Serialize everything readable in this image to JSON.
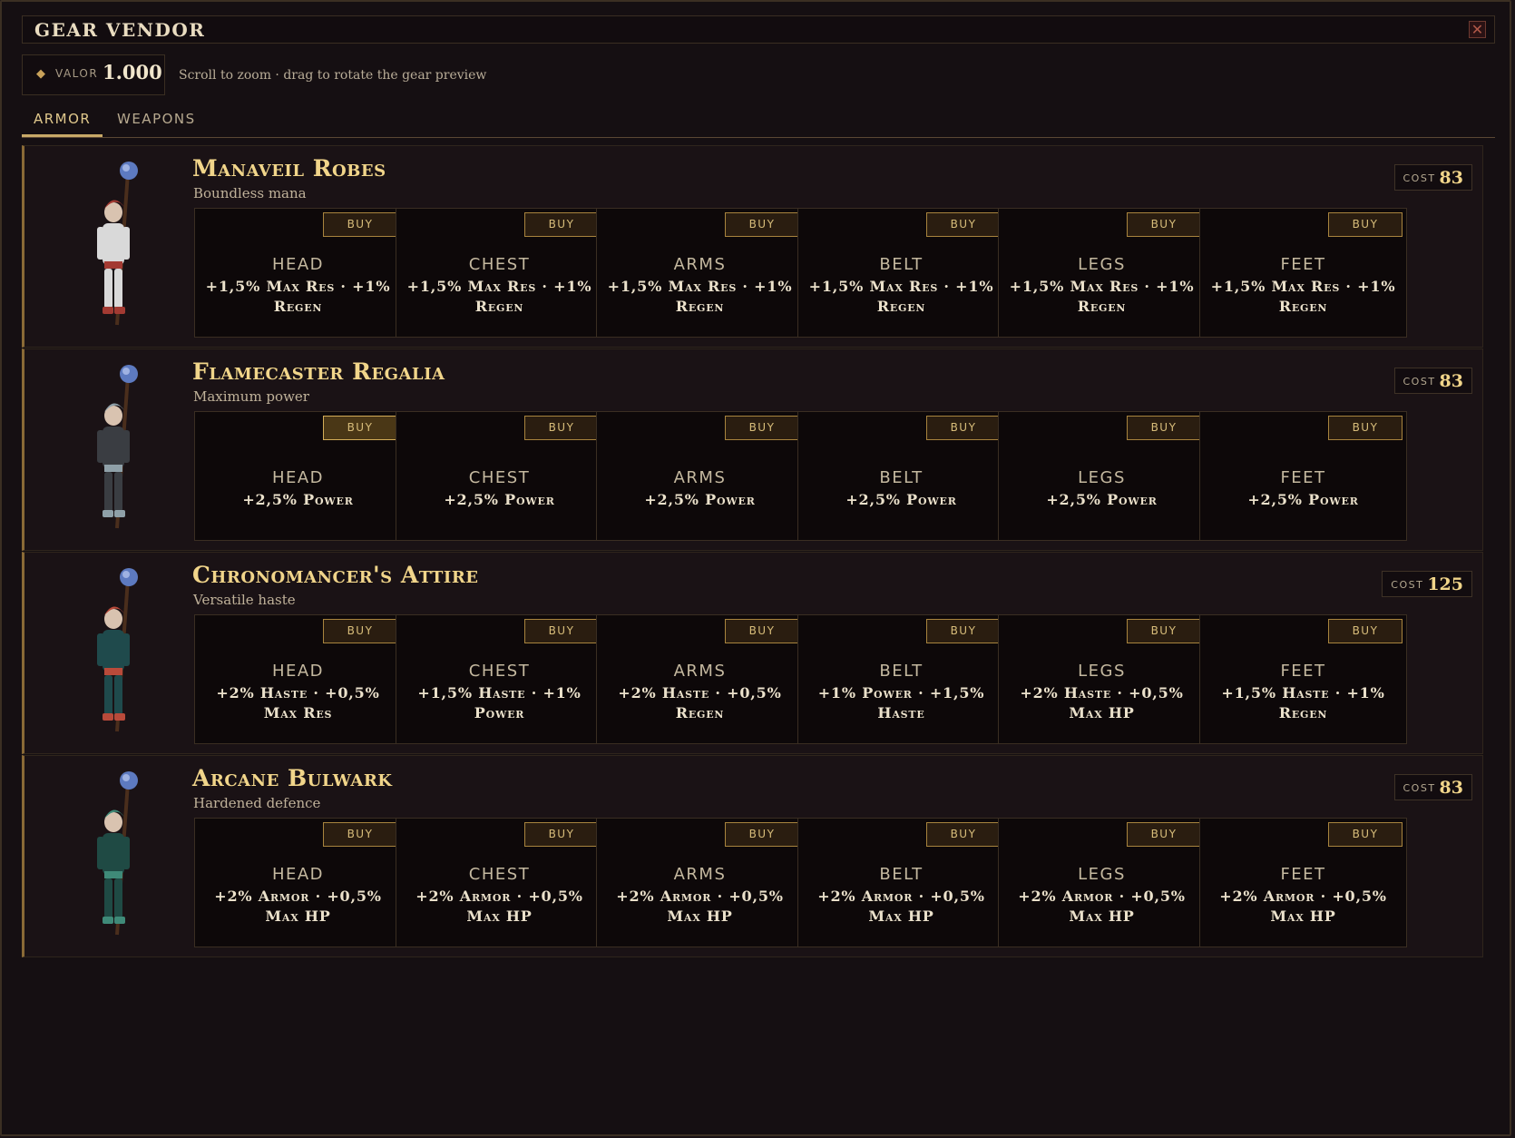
{
  "window": {
    "title": "GEAR VENDOR",
    "close_label": "✕"
  },
  "currency": {
    "icon": "diamond-icon",
    "symbol": "◆",
    "label": "VALOR",
    "amount": "1.000"
  },
  "hint": "Scroll to zoom · drag to rotate the gear preview",
  "tabs": [
    {
      "label": "ARMOR",
      "active": true
    },
    {
      "label": "WEAPONS",
      "active": false
    }
  ],
  "buy_label": "BUY",
  "cost_label": "COST",
  "colors": {
    "accent": "#f1d58a",
    "buy_border": "#a8843e",
    "background": "#150f12"
  },
  "sets": [
    {
      "name": "Manaveil Robes",
      "description": "Boundless mana",
      "cost": "83",
      "preview_colors": {
        "outfit": "#d9d9d9",
        "accent": "#a33a32",
        "orb": "#5d7ac0"
      },
      "pieces": [
        {
          "slot": "HEAD",
          "stat": "+1,5% Max Res · +1% Regen"
        },
        {
          "slot": "CHEST",
          "stat": "+1,5% Max Res · +1% Regen"
        },
        {
          "slot": "ARMS",
          "stat": "+1,5% Max Res · +1% Regen"
        },
        {
          "slot": "BELT",
          "stat": "+1,5% Max Res · +1% Regen"
        },
        {
          "slot": "LEGS",
          "stat": "+1,5% Max Res · +1% Regen"
        },
        {
          "slot": "FEET",
          "stat": "+1,5% Max Res · +1% Regen"
        }
      ]
    },
    {
      "name": "Flamecaster Regalia",
      "description": "Maximum power",
      "cost": "83",
      "preview_colors": {
        "outfit": "#3a3d42",
        "accent": "#8fa0a8",
        "orb": "#5d7ac0"
      },
      "pieces": [
        {
          "slot": "HEAD",
          "stat": "+2,5% Power"
        },
        {
          "slot": "CHEST",
          "stat": "+2,5% Power"
        },
        {
          "slot": "ARMS",
          "stat": "+2,5% Power"
        },
        {
          "slot": "BELT",
          "stat": "+2,5% Power"
        },
        {
          "slot": "LEGS",
          "stat": "+2,5% Power"
        },
        {
          "slot": "FEET",
          "stat": "+2,5% Power"
        }
      ]
    },
    {
      "name": "Chronomancer's Attire",
      "description": "Versatile haste",
      "cost": "125",
      "preview_colors": {
        "outfit": "#1f4a4c",
        "accent": "#b94a3a",
        "orb": "#5d7ac0"
      },
      "pieces": [
        {
          "slot": "HEAD",
          "stat": "+2% Haste · +0,5% Max Res"
        },
        {
          "slot": "CHEST",
          "stat": "+1,5% Haste · +1% Power"
        },
        {
          "slot": "ARMS",
          "stat": "+2% Haste · +0,5% Regen"
        },
        {
          "slot": "BELT",
          "stat": "+1% Power · +1,5% Haste"
        },
        {
          "slot": "LEGS",
          "stat": "+2% Haste · +0,5% Max HP"
        },
        {
          "slot": "FEET",
          "stat": "+1,5% Haste · +1% Regen"
        }
      ]
    },
    {
      "name": "Arcane Bulwark",
      "description": "Hardened defence",
      "cost": "83",
      "preview_colors": {
        "outfit": "#1f4a44",
        "accent": "#3f8a78",
        "orb": "#5d7ac0"
      },
      "pieces": [
        {
          "slot": "HEAD",
          "stat": "+2% Armor · +0,5% Max HP"
        },
        {
          "slot": "CHEST",
          "stat": "+2% Armor · +0,5% Max HP"
        },
        {
          "slot": "ARMS",
          "stat": "+2% Armor · +0,5% Max HP"
        },
        {
          "slot": "BELT",
          "stat": "+2% Armor · +0,5% Max HP"
        },
        {
          "slot": "LEGS",
          "stat": "+2% Armor · +0,5% Max HP"
        },
        {
          "slot": "FEET",
          "stat": "+2% Armor · +0,5% Max HP"
        }
      ]
    }
  ]
}
